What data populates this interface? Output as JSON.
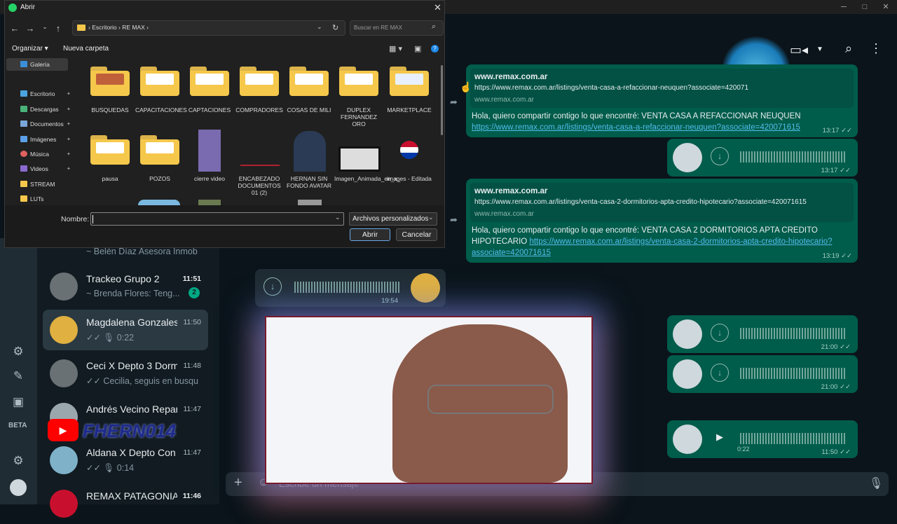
{
  "dialog": {
    "title": "Abrir",
    "breadcrumb": [
      "Escritorio",
      "RE MAX"
    ],
    "search_placeholder": "Buscar en RE MAX",
    "toolbar": {
      "organize": "Organizar",
      "new_folder": "Nueva carpeta"
    },
    "nav": [
      {
        "label": "Galería",
        "color": "#3a8fd8"
      },
      {
        "label": "Escritorio",
        "color": "#4aa3df"
      },
      {
        "label": "Descargas",
        "color": "#49b37a"
      },
      {
        "label": "Documentos",
        "color": "#7aa7d9"
      },
      {
        "label": "Imágenes",
        "color": "#5aa0e8"
      },
      {
        "label": "Música",
        "color": "#e06060"
      },
      {
        "label": "Videos",
        "color": "#8a6ad0"
      },
      {
        "label": "STREAM",
        "color": "#f5c84b"
      },
      {
        "label": "LUTs",
        "color": "#f5c84b"
      }
    ],
    "files": [
      {
        "name": "BUSQUEDAS"
      },
      {
        "name": "CAPACITACIONES"
      },
      {
        "name": "CAPTACIONES"
      },
      {
        "name": "COMPRADORES"
      },
      {
        "name": "COSAS DE MILI"
      },
      {
        "name": "DUPLEX FERNANDEZ ORO"
      },
      {
        "name": "MARKETPLACE"
      },
      {
        "name": "pausa"
      },
      {
        "name": "POZOS"
      },
      {
        "name": "cierre video"
      },
      {
        "name": "ENCABEZADO DOCUMENTOS 01 (2)"
      },
      {
        "name": "HERNAN SIN FONDO AVATAR"
      },
      {
        "name": "Imagen_Animada_en_x_"
      },
      {
        "name": "images - Editada"
      }
    ],
    "filename_label": "Nombre:",
    "filename_value": "",
    "filter": "Archivos personalizados",
    "open_button": "Abrir",
    "cancel_button": "Cancelar"
  },
  "chats": [
    {
      "name": "",
      "last": "~ Belén Díaz Asesora Inmob",
      "time": ""
    },
    {
      "name": "Trackeo Grupo 2",
      "last": "~ Brenda Flores: Teng...",
      "time": "11:51",
      "badge": "2"
    },
    {
      "name": "Magdalena Gonzales ...",
      "last": "0:22",
      "time": "11:50"
    },
    {
      "name": "Ceci X Depto 3 Dorm...",
      "last": "Cecilia, seguis en busqued...",
      "time": "11:48"
    },
    {
      "name": "Andrés Vecino Repart...",
      "last": "",
      "time": "11:47"
    },
    {
      "name": "Aldana X Depto Con ...",
      "last": "0:14",
      "time": "11:47"
    },
    {
      "name": "REMAX PATAGONIA",
      "last": "",
      "time": "11:46"
    }
  ],
  "rail": {
    "beta": "BETA"
  },
  "watermark": "FHERN014",
  "messages": {
    "m1": {
      "domain": "www.remax.com.ar",
      "url": "https://www.remax.com.ar/listings/venta-casa-a-refaccionar-neuquen?associate=420071",
      "site": "www.remax.com.ar",
      "text": "Hola, quiero compartir contigo lo que encontré: VENTA CASA A REFACCIONAR NEUQUEN",
      "link": "https://www.remax.com.ar/listings/venta-casa-a-refaccionar-neuquen?associate=420071615",
      "time": "13:17"
    },
    "v1": {
      "time": "13:17"
    },
    "m2": {
      "domain": "www.remax.com.ar",
      "url": "https://www.remax.com.ar/listings/venta-casa-2-dormitorios-apta-credito-hipotecario?associate=420071615",
      "site": "www.remax.com.ar",
      "text": "Hola, quiero compartir contigo lo que encontré: VENTA CASA 2 DORMITORIOS APTA CREDITO HIPOTECARIO",
      "link": "https://www.remax.com.ar/listings/venta-casa-2-dormitorios-apta-credito-hipotecario?associate=420071615",
      "time": "13:19"
    },
    "vin": {
      "time": "19:54"
    },
    "v2": {
      "time": "21:00"
    },
    "v3": {
      "time": "21:00"
    },
    "v4": {
      "time": "11:50",
      "duration": "0:22"
    }
  },
  "compose_placeholder": "Escribe un mensaje"
}
